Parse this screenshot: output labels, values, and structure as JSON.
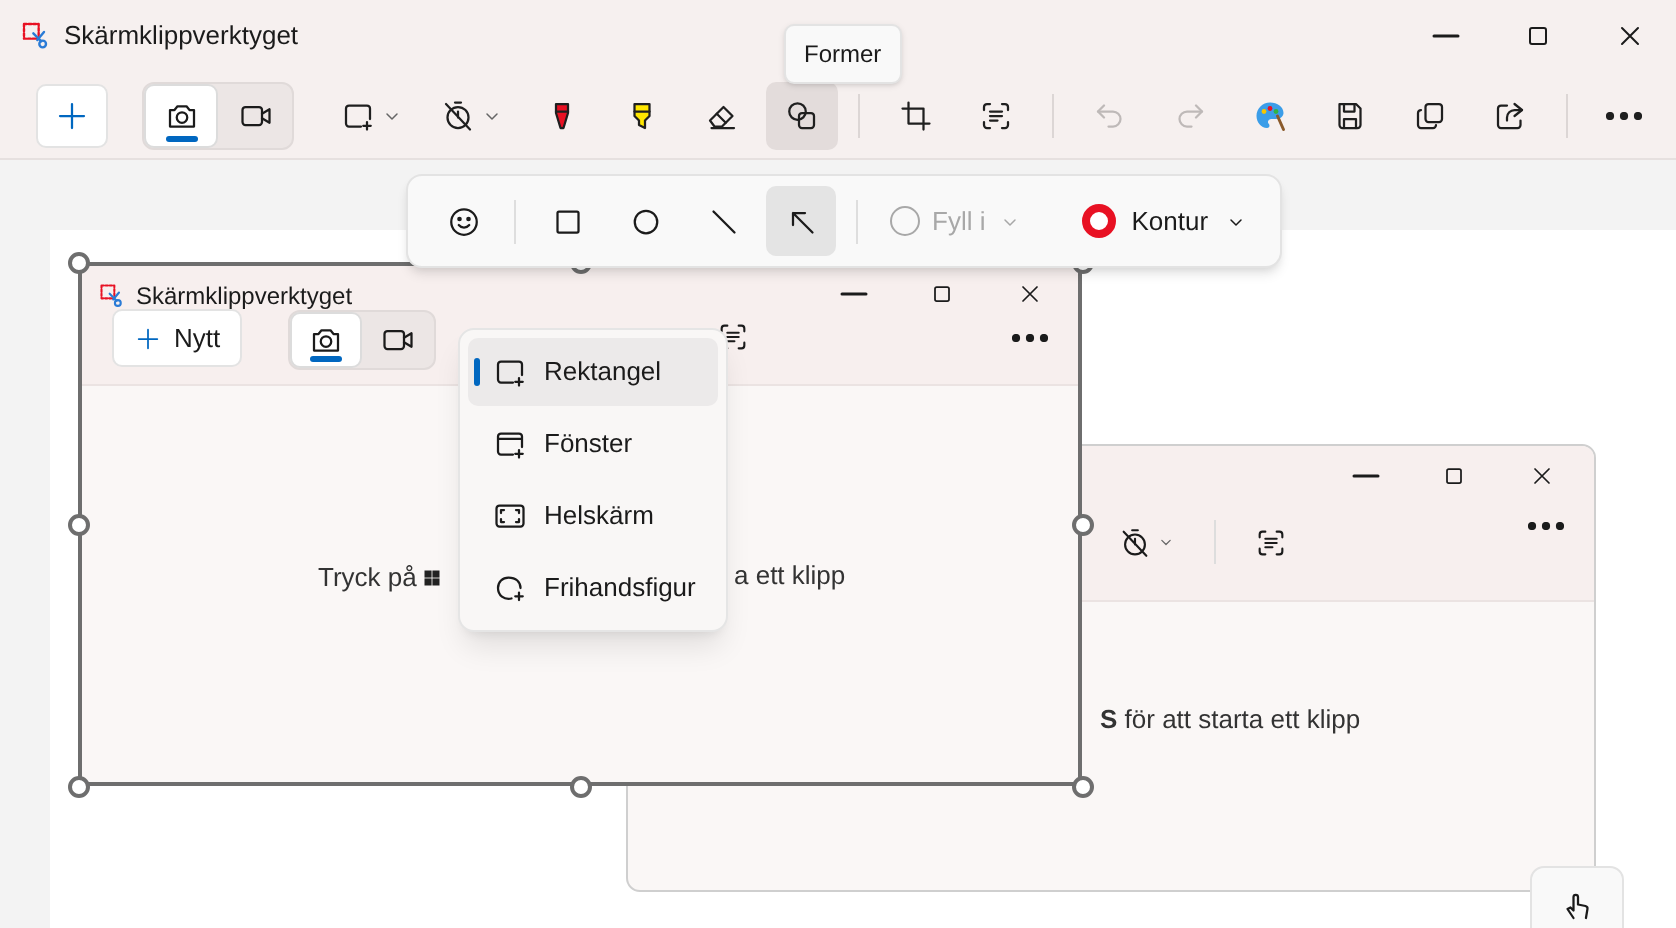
{
  "window": {
    "title": "Skärmklippverktyget"
  },
  "tooltip": "Former",
  "toolbar": {
    "modes": [
      {
        "kind": "camera",
        "selected": true
      },
      {
        "kind": "video",
        "selected": false
      }
    ],
    "tools": [
      {
        "kind": "rect-snip",
        "selected": false,
        "disabled": false
      },
      {
        "kind": "timer",
        "selected": false,
        "disabled": false
      },
      {
        "kind": "pen",
        "selected": false,
        "disabled": false
      },
      {
        "kind": "highlighter",
        "selected": false,
        "disabled": false
      },
      {
        "kind": "eraser",
        "selected": false,
        "disabled": false
      },
      {
        "kind": "shapes",
        "selected": true,
        "disabled": false
      },
      {
        "kind": "separator"
      },
      {
        "kind": "crop",
        "selected": false,
        "disabled": false
      },
      {
        "kind": "text-extract",
        "selected": false,
        "disabled": false
      },
      {
        "kind": "separator"
      },
      {
        "kind": "undo",
        "selected": false,
        "disabled": true
      },
      {
        "kind": "redo",
        "selected": false,
        "disabled": true
      },
      {
        "kind": "paint",
        "selected": false,
        "disabled": false
      },
      {
        "kind": "save",
        "selected": false,
        "disabled": false
      },
      {
        "kind": "copy",
        "selected": false,
        "disabled": false
      },
      {
        "kind": "share",
        "selected": false,
        "disabled": false
      },
      {
        "kind": "separator"
      },
      {
        "kind": "more",
        "selected": false,
        "disabled": false
      }
    ]
  },
  "shapes_flyout": {
    "shapes": [
      {
        "kind": "emoji",
        "selected": false
      },
      {
        "kind": "separator"
      },
      {
        "kind": "rectangle",
        "selected": false
      },
      {
        "kind": "ellipse",
        "selected": false
      },
      {
        "kind": "line",
        "selected": false
      },
      {
        "kind": "arrow",
        "selected": true
      }
    ],
    "fill": {
      "label": "Fyll i",
      "disabled": true
    },
    "outline": {
      "label": "Kontur",
      "color": "#e81123"
    }
  },
  "screenshot": {
    "back_window": {
      "hint": "**S** för att starta ett klipp"
    },
    "front_window": {
      "title": "Skärmklippverktyget",
      "new_button": "Nytt",
      "modes": [
        {
          "kind": "camera",
          "selected": true
        },
        {
          "kind": "video",
          "selected": false
        }
      ],
      "hint_start": "Tryck på",
      "hint_end": "a ett klipp"
    },
    "snip_menu": [
      {
        "kind": "rect-snip",
        "label": "Rektangel",
        "selected": true
      },
      {
        "kind": "window-snip",
        "label": "Fönster",
        "selected": false
      },
      {
        "kind": "fullscreen",
        "label": "Helskärm",
        "selected": false
      },
      {
        "kind": "freeform",
        "label": "Frihandsfigur",
        "selected": false
      }
    ]
  }
}
